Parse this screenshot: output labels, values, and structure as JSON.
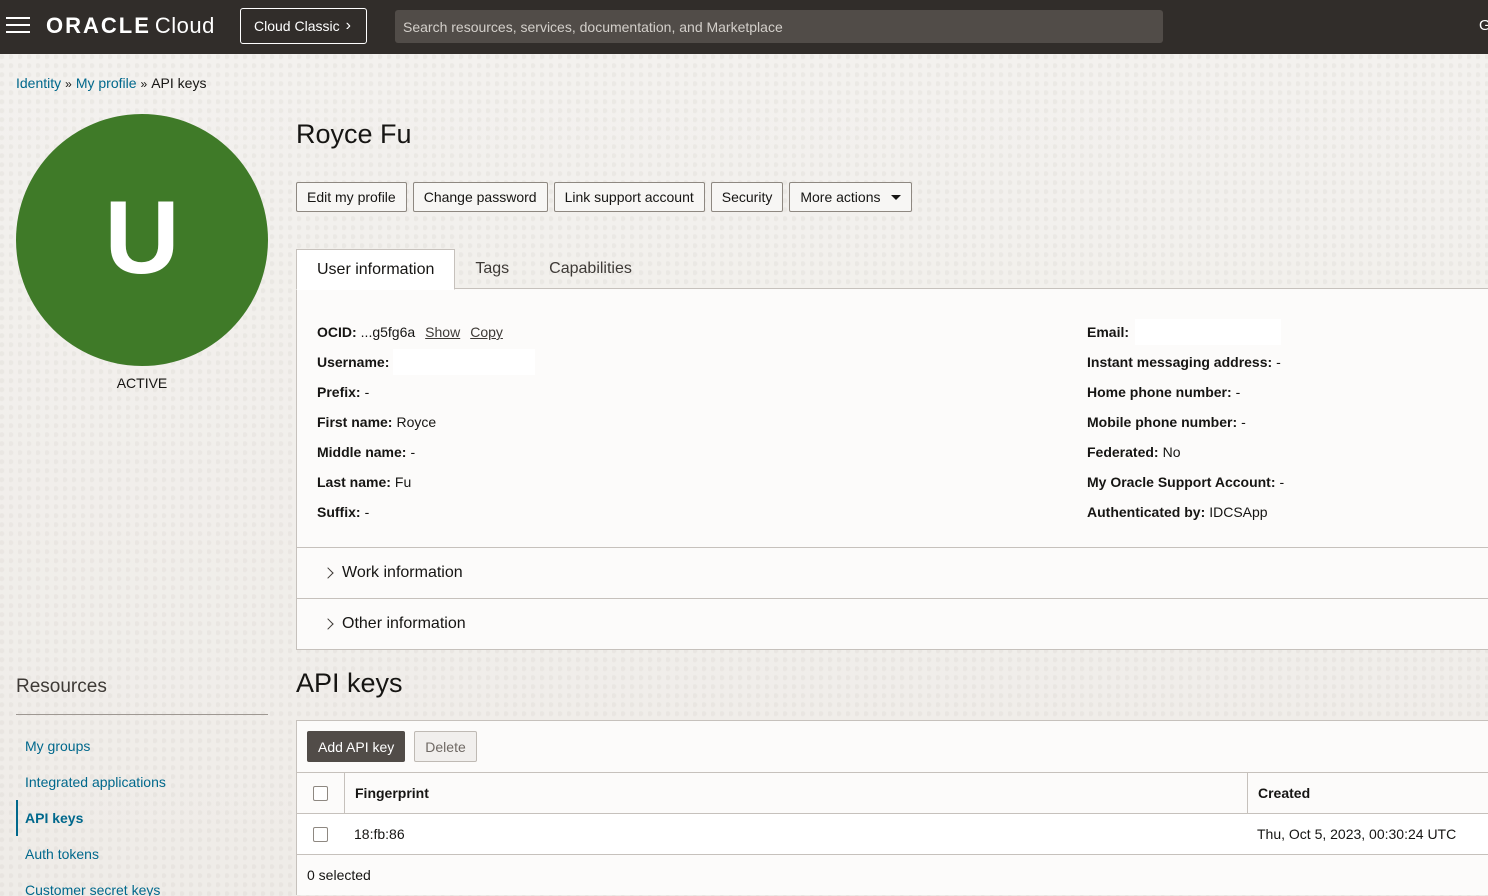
{
  "topbar": {
    "logo_brand": "ORACLE",
    "logo_product": "Cloud",
    "classic_label": "Cloud Classic",
    "search_placeholder": "Search resources, services, documentation, and Marketplace",
    "right_glyph": "G",
    "bg_color": "#312d2a"
  },
  "breadcrumb": {
    "items": [
      "Identity",
      "My profile",
      "API keys"
    ],
    "separator": "»"
  },
  "profile": {
    "avatar_letter": "U",
    "avatar_color": "#3f7a28",
    "status": "ACTIVE",
    "name": "Royce Fu"
  },
  "actions": {
    "edit": "Edit my profile",
    "change_password": "Change password",
    "link_support": "Link support account",
    "security": "Security",
    "more": "More actions"
  },
  "tabs": [
    "User information",
    "Tags",
    "Capabilities"
  ],
  "user_info": {
    "left": [
      {
        "label": "OCID:",
        "value": "...g5fg6a"
      },
      {
        "label": "Username:",
        "value": ""
      },
      {
        "label": "Prefix:",
        "value": "-"
      },
      {
        "label": "First name:",
        "value": "Royce"
      },
      {
        "label": "Middle name:",
        "value": "-"
      },
      {
        "label": "Last name:",
        "value": "Fu"
      },
      {
        "label": "Suffix:",
        "value": "-"
      }
    ],
    "ocid_show": "Show",
    "ocid_copy": "Copy",
    "right": [
      {
        "label": "Email:",
        "value": ""
      },
      {
        "label": "Instant messaging address:",
        "value": "-"
      },
      {
        "label": "Home phone number:",
        "value": "-"
      },
      {
        "label": "Mobile phone number:",
        "value": "-"
      },
      {
        "label": "Federated:",
        "value": "No"
      },
      {
        "label": "My Oracle Support Account:",
        "value": "-"
      },
      {
        "label": "Authenticated by:",
        "value": "IDCSApp"
      }
    ]
  },
  "sections": {
    "work": "Work information",
    "other": "Other information"
  },
  "resources": {
    "title": "Resources",
    "items": [
      "My groups",
      "Integrated applications",
      "API keys",
      "Auth tokens",
      "Customer secret keys"
    ],
    "active": "API keys"
  },
  "api_keys": {
    "title": "API keys",
    "add_label": "Add API key",
    "delete_label": "Delete",
    "columns": [
      "Fingerprint",
      "Created"
    ],
    "rows": [
      {
        "fingerprint": "18:fb:86",
        "created": "Thu, Oct 5, 2023, 00:30:24 UTC"
      }
    ],
    "selected_text": "0 selected"
  }
}
